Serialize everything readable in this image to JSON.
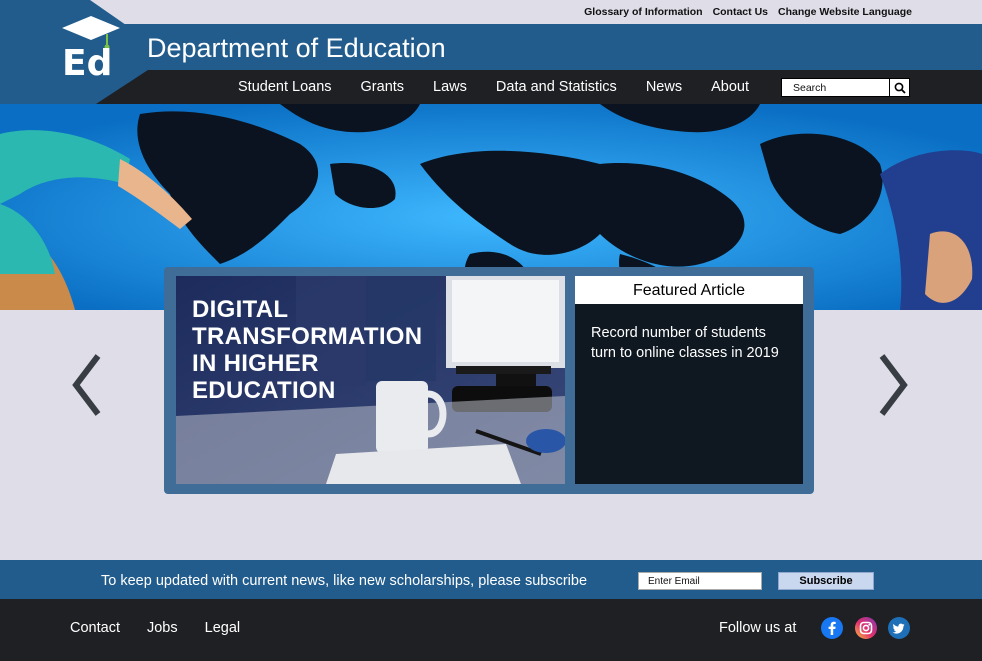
{
  "utility": {
    "links": [
      "Glossary of Information",
      "Contact Us",
      "Change Website Language"
    ]
  },
  "header": {
    "title": "Department of Education",
    "logo_text": "Ed"
  },
  "nav": {
    "items": [
      "Student Loans",
      "Grants",
      "Laws",
      "Data and Statistics",
      "News",
      "About"
    ]
  },
  "search": {
    "placeholder": "Search",
    "icon": "search-icon"
  },
  "carousel": {
    "headline": "Digital\nTransformation\nin Higher\nEducation",
    "featured_label": "Featured Article",
    "featured_text": "Record number of students turn to online classes in 2019",
    "prev_icon": "chevron-left-icon",
    "next_icon": "chevron-right-icon"
  },
  "subscribe": {
    "text": "To keep updated with current news, like new scholarships, please subscribe",
    "email_placeholder": "Enter Email",
    "button_label": "Subscribe"
  },
  "footer": {
    "links": [
      "Contact",
      "Jobs",
      "Legal"
    ],
    "follow_label": "Follow us at",
    "social_icons": [
      "facebook-icon",
      "instagram-icon",
      "twitter-icon"
    ]
  },
  "colors": {
    "brand_blue": "#215c8d",
    "dark_bar": "#1f2023",
    "page_bg": "#dfdde8",
    "logo_green": "#7cc243"
  }
}
